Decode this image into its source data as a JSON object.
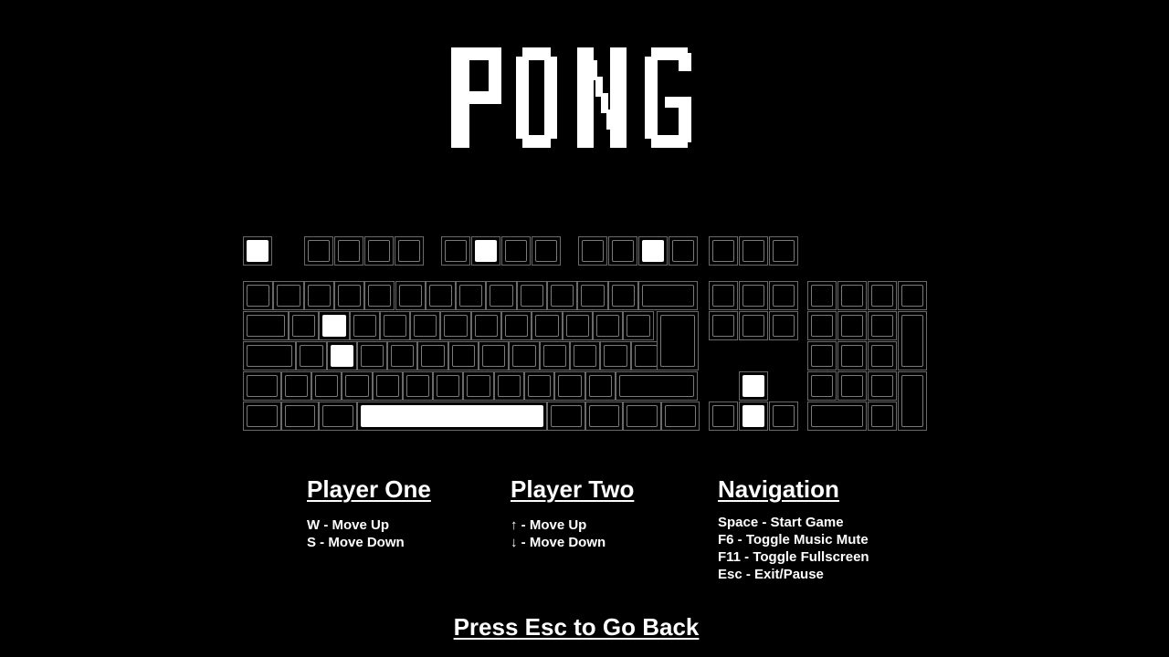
{
  "title": "PONG",
  "keyboard": {
    "highlighted_keys": [
      "Esc",
      "F6",
      "F11",
      "W",
      "S",
      "Space",
      "Up Arrow",
      "Down Arrow"
    ]
  },
  "controls": [
    {
      "heading": "Player One",
      "items": [
        "W - Move Up",
        "S - Move Down"
      ]
    },
    {
      "heading": "Player Two",
      "items": [
        "↑ - Move Up",
        "↓ - Move Down"
      ]
    },
    {
      "heading": "Navigation",
      "items": [
        "Space - Start Game",
        "F6 - Toggle Music Mute",
        "F11 - Toggle Fullscreen",
        "Esc - Exit/Pause"
      ]
    }
  ],
  "footer": {
    "back_label": "Press Esc to Go Back"
  },
  "colors": {
    "background": "#000000",
    "foreground": "#ffffff",
    "key_border": "#6a6a6a"
  }
}
